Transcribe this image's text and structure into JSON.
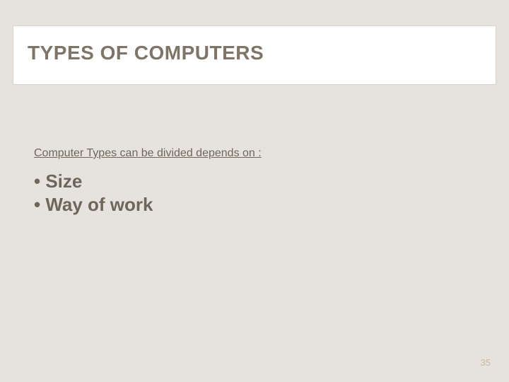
{
  "title": "TYPES OF COMPUTERS",
  "subheading": "Computer Types can be divided depends on :",
  "bullets": [
    "Size",
    "Way of work"
  ],
  "pageNumber": "35"
}
